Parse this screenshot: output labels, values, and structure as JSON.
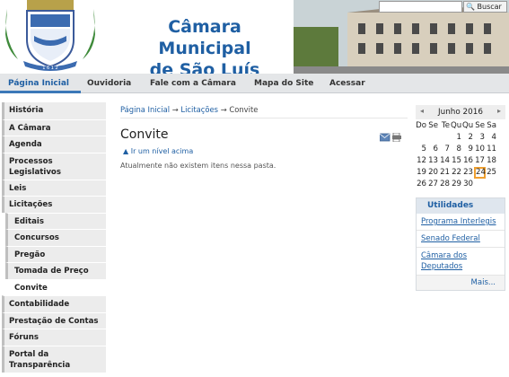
{
  "header": {
    "site_title_line1": "Câmara Municipal",
    "site_title_line2": "de São Luís",
    "search_button": "Buscar",
    "search_placeholder": ""
  },
  "nav": {
    "items": [
      {
        "label": "Página Inicial",
        "active": true
      },
      {
        "label": "Ouvidoria"
      },
      {
        "label": "Fale com a Câmara"
      },
      {
        "label": "Mapa do Site"
      },
      {
        "label": "Acessar"
      }
    ]
  },
  "sidebar": {
    "items": [
      {
        "label": "História"
      },
      {
        "label": "A Câmara"
      },
      {
        "label": "Agenda"
      },
      {
        "label": "Processos Legislativos"
      },
      {
        "label": "Leis"
      },
      {
        "label": "Licitações"
      },
      {
        "label": "Editais"
      },
      {
        "label": "Concursos"
      },
      {
        "label": "Pregão"
      },
      {
        "label": "Tomada de Preço"
      },
      {
        "label": "Convite"
      },
      {
        "label": "Contabilidade"
      },
      {
        "label": "Prestação de Contas"
      },
      {
        "label": "Fóruns"
      },
      {
        "label": "Portal da Transparência"
      }
    ]
  },
  "breadcrumb": {
    "home": "Página Inicial",
    "sep": "→",
    "section": "Licitações",
    "current": "Convite"
  },
  "main": {
    "title": "Convite",
    "up_link": "Ir um nível acima",
    "empty_message": "Atualmente não existem itens nessa pasta."
  },
  "calendar": {
    "month": "Junho 2016",
    "prev": "◂",
    "next": "▸",
    "weekdays": [
      "Do",
      "Se",
      "Te",
      "Qu",
      "Qu",
      "Se",
      "Sa"
    ],
    "days": [
      "",
      "",
      "",
      "1",
      "2",
      "3",
      "4",
      "5",
      "6",
      "7",
      "8",
      "9",
      "10",
      "11",
      "12",
      "13",
      "14",
      "15",
      "16",
      "17",
      "18",
      "19",
      "20",
      "21",
      "22",
      "23",
      "24",
      "25",
      "26",
      "27",
      "28",
      "29",
      "30",
      "",
      ""
    ],
    "today": "24"
  },
  "utilities": {
    "title": "Utilidades",
    "links": [
      "Programa Interlegis",
      "Senado Federal",
      "Câmara dos Deputados"
    ],
    "more": "Mais..."
  },
  "colors": {
    "brand_blue": "#1f5fa3",
    "nav_bg": "#e4e6e8",
    "today_border": "#f0a030"
  }
}
